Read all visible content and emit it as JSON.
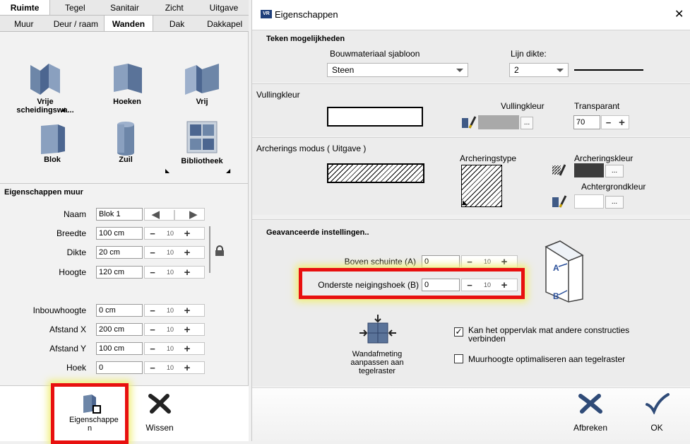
{
  "left": {
    "tabs_top": [
      "Ruimte",
      "Tegel",
      "Sanitair",
      "Zicht",
      "Uitgave"
    ],
    "tabs_sub": [
      "Muur",
      "Deur / raam",
      "Wanden",
      "Dak",
      "Dakkapel"
    ],
    "tools": [
      "Vrije scheidingswa...",
      "Hoeken",
      "Vrij",
      "Blok",
      "Zuil",
      "Bibliotheek"
    ],
    "props_title": "Eigenschappen muur",
    "fields": {
      "naam": {
        "label": "Naam",
        "value": "Blok 1"
      },
      "breedte": {
        "label": "Breedte",
        "value": "100 cm",
        "step": "10"
      },
      "dikte": {
        "label": "Dikte",
        "value": "20 cm",
        "step": "10"
      },
      "hoogte": {
        "label": "Hoogte",
        "value": "120 cm",
        "step": "10"
      },
      "inbouwhoogte": {
        "label": "Inbouwhoogte",
        "value": "0 cm",
        "step": "10"
      },
      "afstand_x": {
        "label": "Afstand X",
        "value": "200 cm",
        "step": "10"
      },
      "afstand_y": {
        "label": "Afstand Y",
        "value": "100 cm",
        "step": "10"
      },
      "hoek": {
        "label": "Hoek",
        "value": "0",
        "step": "10"
      }
    },
    "bottom": {
      "eigenschappen": "Eigenschappe n",
      "wissen": "Wissen"
    }
  },
  "dialog": {
    "title": "Eigenschappen",
    "close": "✕",
    "teken": {
      "heading": "Teken mogelijkheden",
      "bouwmateriaal_label": "Bouwmateriaal sjabloon",
      "bouwmateriaal_value": "Steen",
      "lijndikte_label": "Lijn dikte:",
      "lijndikte_value": "2"
    },
    "vulling": {
      "heading": "Vullingkleur",
      "vullingkleur_label": "Vullingkleur",
      "transparant_label": "Transparant",
      "transparant_value": "70",
      "dots": "..."
    },
    "archering": {
      "heading": "Archerings modus ( Uitgave )",
      "type_label": "Archeringstype",
      "kleur_label": "Archeringskleur",
      "achtergrond_label": "Achtergrondkleur",
      "dots": "..."
    },
    "geavanceerd": {
      "heading": "Geavanceerde instellingen..",
      "boven_label": "Boven schuinte (A)",
      "boven_value": "0",
      "onder_label": "Onderste neigingshoek (B)",
      "onder_value": "0",
      "step": "10",
      "label_a": "A",
      "label_b": "B",
      "wandafmeting": "Wandafmeting aanpassen aan tegelraster",
      "check1": "Kan het oppervlak mat andere constructies verbinden",
      "check2": "Muurhoogte optimaliseren aan tegelraster"
    },
    "buttons": {
      "afbreken": "Afbreken",
      "ok": "OK"
    }
  },
  "colors": {
    "highlight_red": "#e8100f",
    "fill_grey": "#a9a9a9",
    "hatch_color": "#3c3c3c"
  }
}
